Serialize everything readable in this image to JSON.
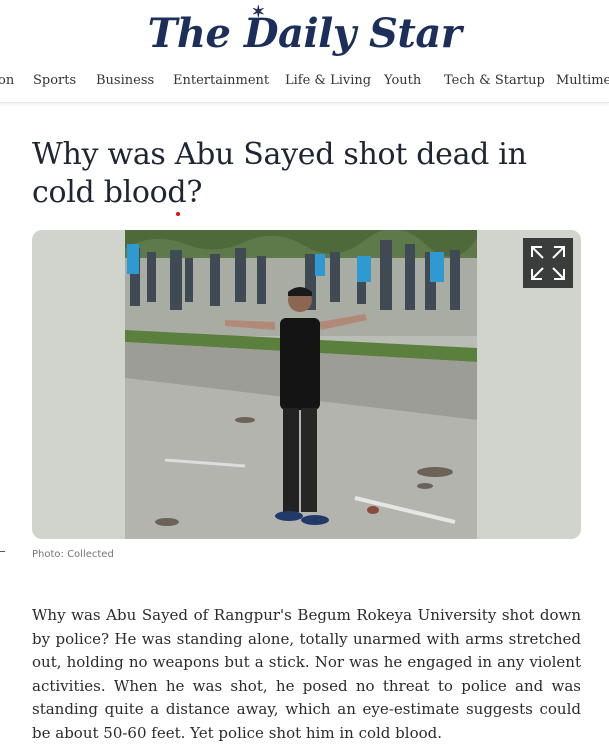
{
  "site": {
    "logo": "The Daily Star"
  },
  "nav": {
    "items": [
      {
        "label": "on"
      },
      {
        "label": "Sports"
      },
      {
        "label": "Business"
      },
      {
        "label": "Entertainment"
      },
      {
        "label": "Life & Living"
      },
      {
        "label": "Youth"
      },
      {
        "label": "Tech & Startup"
      },
      {
        "label": "Multimedia"
      }
    ]
  },
  "article": {
    "headline": "Why was Abu Sayed shot dead in cold blood?",
    "photo_caption": "Photo: Collected",
    "body": "Why was Abu Sayed of Rangpur's Begum Rokeya University shot down by police? He was standing alone, totally unarmed with arms stretched out, holding no weapons but a stick. Nor was he engaged in any violent activities. When he was shot, he posed no threat to police and was standing quite a distance away, which an eye-estimate suggests could be about 50-60 feet. Yet police shot him in cold blood."
  },
  "icons": {
    "expand": "expand-icon"
  },
  "colors": {
    "brand": "#1b2f5a",
    "headline": "#1e2533",
    "figure_bg": "#d0d4cd"
  }
}
